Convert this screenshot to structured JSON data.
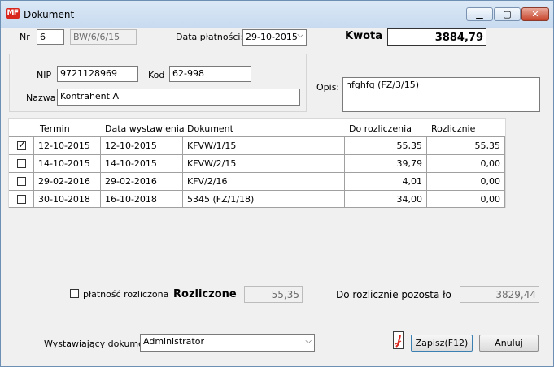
{
  "window": {
    "title": "Dokument",
    "app_icon_text": "MF",
    "icons": {
      "app": "mf-app-icon",
      "minimize": "minimize-icon",
      "maximize": "maximize-icon",
      "close": "close-icon"
    }
  },
  "header": {
    "nr_label": "Nr",
    "nr_value": "6",
    "doc_code": "BW/6/6/15",
    "payment_date_label": "Data płatności:",
    "payment_date_value": "29-10-2015",
    "amount_label": "Kwota",
    "amount_value": "3884,79"
  },
  "contractor": {
    "nip_label": "NIP",
    "nip_value": "9721128969",
    "kod_label": "Kod",
    "kod_value": "62-998",
    "name_label": "Nazwa",
    "name_value": "Kontrahent A"
  },
  "description": {
    "label": "Opis:",
    "value": "hfghfg (FZ/3/15)"
  },
  "table": {
    "columns": [
      "Termin",
      "Data wystawienia",
      "Dokument",
      "Do rozliczenia",
      "Rozlicznie"
    ],
    "rows": [
      {
        "checked": true,
        "termin": "12-10-2015",
        "data": "12-10-2015",
        "dokument": "KFVW/1/15",
        "do_rozliczenia": "55,35",
        "rozlicznie": "55,35"
      },
      {
        "checked": false,
        "termin": "14-10-2015",
        "data": "14-10-2015",
        "dokument": "KFVW/2/15",
        "do_rozliczenia": "39,79",
        "rozlicznie": "0,00"
      },
      {
        "checked": false,
        "termin": "29-02-2016",
        "data": "29-02-2016",
        "dokument": "KFV/2/16",
        "do_rozliczenia": "4,01",
        "rozlicznie": "0,00"
      },
      {
        "checked": false,
        "termin": "30-10-2018",
        "data": "16-10-2018",
        "dokument": "5345 (FZ/1/18)",
        "do_rozliczenia": "34,00",
        "rozlicznie": "0,00"
      }
    ]
  },
  "summary": {
    "settled_checkbox_label": "płatność rozliczona",
    "settled_checked": false,
    "rozliczone_label": "Rozliczone",
    "rozliczone_value": "55,35",
    "remaining_label": "Do rozlicznie pozosta ło",
    "remaining_value": "3829,44"
  },
  "footer": {
    "issuer_label": "Wystawiający dokument",
    "issuer_value": "Administrator",
    "pdf_icon": "pdf-icon",
    "save_label": "Zapisz(F12)",
    "cancel_label": "Anuluj"
  },
  "colors": {
    "titlebar": "#c7daef",
    "close_button": "#c7442b",
    "pdf_icon": "#d9261c"
  }
}
